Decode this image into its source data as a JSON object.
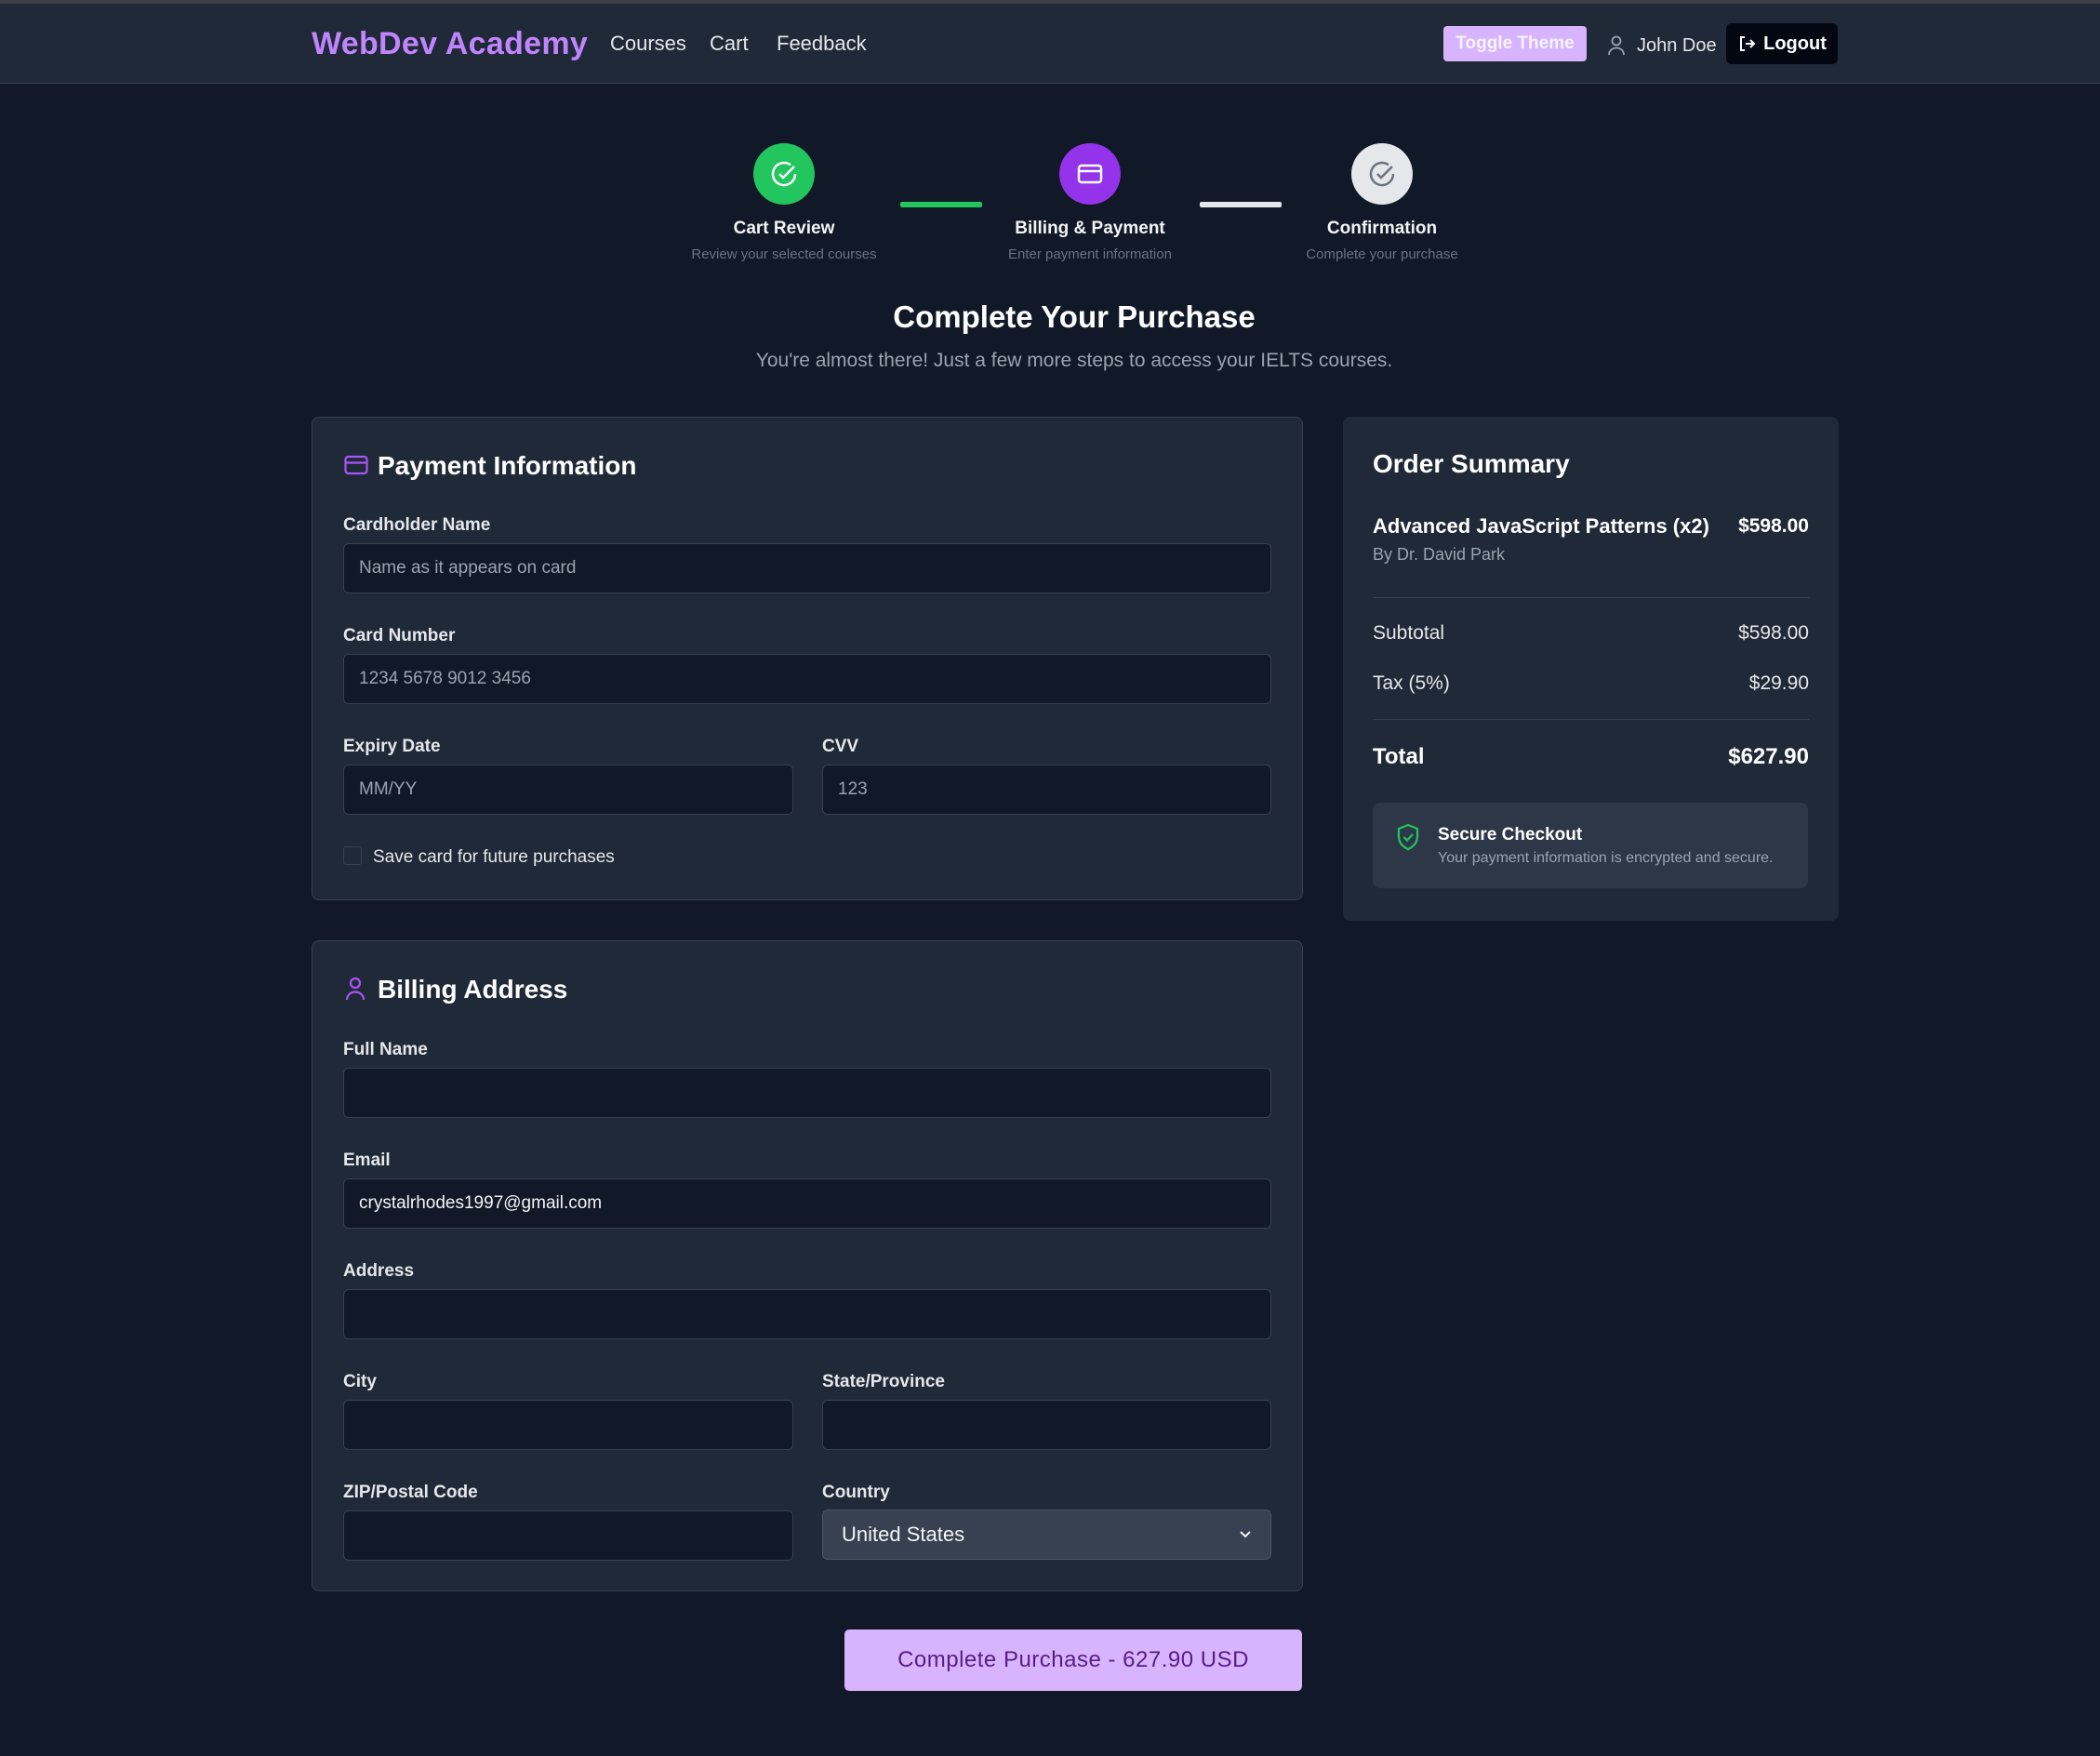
{
  "header": {
    "brand": "WebDev Academy",
    "nav": [
      "Courses",
      "Cart",
      "Feedback"
    ],
    "toggle_theme": "Toggle Theme",
    "user_name": "John Doe",
    "logout": "Logout"
  },
  "stepper": {
    "steps": [
      {
        "title": "Cart Review",
        "desc": "Review your selected courses",
        "state": "completed",
        "color": "#22c55e"
      },
      {
        "title": "Billing & Payment",
        "desc": "Enter payment information",
        "state": "active",
        "color": "#9333ea"
      },
      {
        "title": "Confirmation",
        "desc": "Complete your purchase",
        "state": "pending",
        "color": "#e5e7eb"
      }
    ]
  },
  "page": {
    "title": "Complete Your Purchase",
    "subtitle": "You're almost there! Just a few more steps to access your IELTS courses."
  },
  "payment": {
    "title": "Payment Information",
    "cardholder_label": "Cardholder Name",
    "cardholder_placeholder": "Name as it appears on card",
    "card_number_label": "Card Number",
    "card_number_placeholder": "1234 5678 9012 3456",
    "expiry_label": "Expiry Date",
    "expiry_placeholder": "MM/YY",
    "cvv_label": "CVV",
    "cvv_placeholder": "123",
    "save_card_label": "Save card for future purchases"
  },
  "billing": {
    "title": "Billing Address",
    "full_name_label": "Full Name",
    "full_name_value": "",
    "email_label": "Email",
    "email_value": "crystalrhodes1997@gmail.com",
    "address_label": "Address",
    "address_value": "",
    "city_label": "City",
    "state_label": "State/Province",
    "zip_label": "ZIP/Postal Code",
    "country_label": "Country",
    "country_value": "United States"
  },
  "summary": {
    "title": "Order Summary",
    "item_name": "Advanced JavaScript Patterns (x2)",
    "item_author": "By Dr. David Park",
    "item_price": "$598.00",
    "subtotal_label": "Subtotal",
    "subtotal_value": "$598.00",
    "tax_label": "Tax (5%)",
    "tax_value": "$29.90",
    "total_label": "Total",
    "total_value": "$627.90",
    "secure_title": "Secure Checkout",
    "secure_desc": "Your payment information is encrypted and secure."
  },
  "purchase_button": "Complete Purchase - 627.90 USD",
  "colors": {
    "accent": "#c084fc",
    "button_bg": "#d8b4fe",
    "success": "#22c55e",
    "active_step": "#9333ea",
    "background": "#111827",
    "card": "#1f2937"
  }
}
